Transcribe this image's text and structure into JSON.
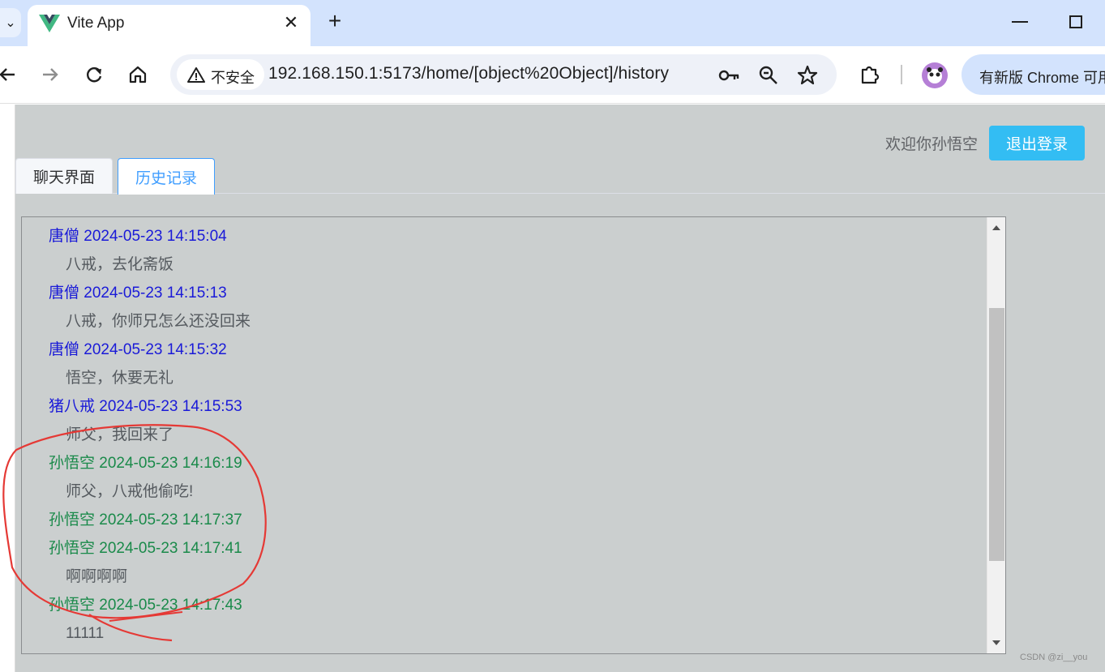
{
  "browser": {
    "tab_title": "Vite App",
    "tab_close_symbol": "✕",
    "new_tab_symbol": "+",
    "security_label": "不安全",
    "url": "192.168.150.1:5173/home/[object%20Object]/history",
    "update_text": "有新版 Chrome 可用",
    "icons": [
      "tab-search-icon",
      "back-icon",
      "forward-icon",
      "reload-icon",
      "home-icon",
      "warning-icon",
      "key-icon",
      "zoom-icon",
      "star-icon",
      "extensions-icon",
      "profile-avatar-icon"
    ]
  },
  "header": {
    "welcome": "欢迎你孙悟空",
    "logout_label": "退出登录"
  },
  "tabs": [
    {
      "label": "聊天界面",
      "active": false
    },
    {
      "label": "历史记录",
      "active": true
    }
  ],
  "messages": [
    {
      "sender": "唐僧",
      "time": "2024-05-23 14:15:04",
      "text": "八戒，去化斋饭",
      "color": "#1a1ad8"
    },
    {
      "sender": "唐僧",
      "time": "2024-05-23 14:15:13",
      "text": "八戒，你师兄怎么还没回来",
      "color": "#1a1ad8"
    },
    {
      "sender": "唐僧",
      "time": "2024-05-23 14:15:32",
      "text": "悟空，休要无礼",
      "color": "#1a1ad8"
    },
    {
      "sender": "猪八戒",
      "time": "2024-05-23 14:15:53",
      "text": "师父，我回来了",
      "color": "#1a1ad8"
    },
    {
      "sender": "孙悟空",
      "time": "2024-05-23 14:16:19",
      "text": "师父，八戒他偷吃!",
      "color": "#1a8a4a"
    },
    {
      "sender": "孙悟空",
      "time": "2024-05-23 14:17:37",
      "text": "",
      "color": "#1a8a4a"
    },
    {
      "sender": "孙悟空",
      "time": "2024-05-23 14:17:41",
      "text": "啊啊啊啊",
      "color": "#1a8a4a"
    },
    {
      "sender": "孙悟空",
      "time": "2024-05-23 14:17:43",
      "text": "11111",
      "color": "#1a8a4a"
    }
  ],
  "watermark": "CSDN @zi__you",
  "colors": {
    "accent": "#33bdf3",
    "active_tab": "#409eff",
    "annotation": "#e53935"
  }
}
